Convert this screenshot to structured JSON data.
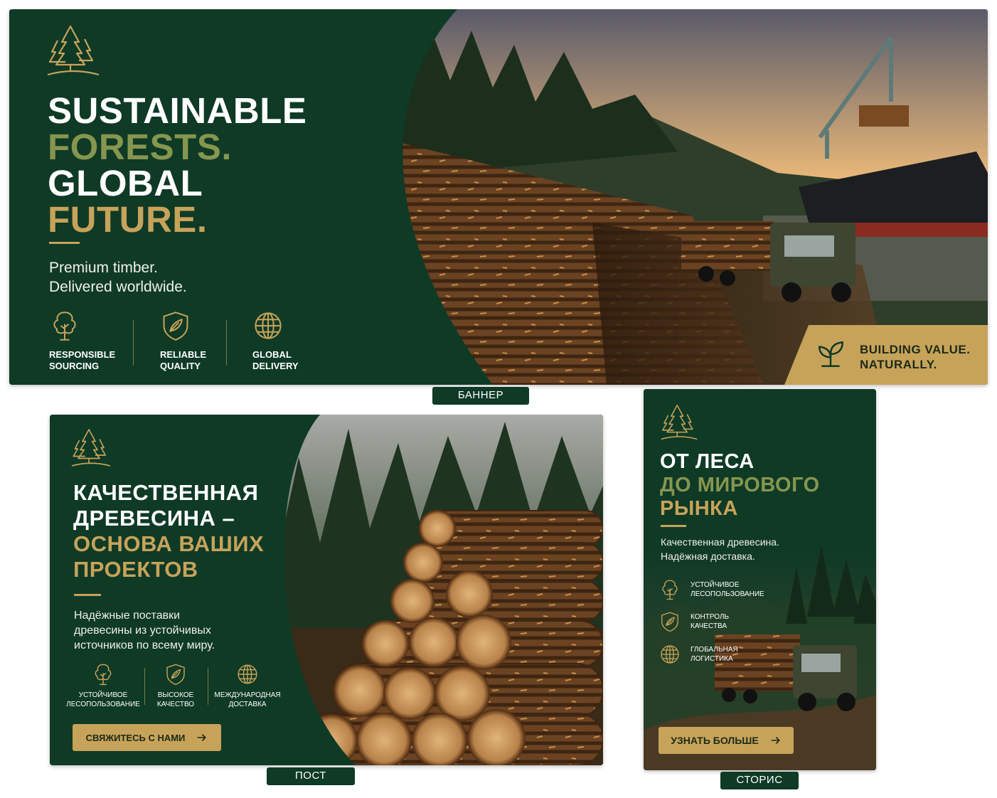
{
  "banner": {
    "headline": [
      "SUSTAINABLE",
      "FORESTS.",
      "GLOBAL",
      "FUTURE."
    ],
    "subtitle": [
      "Premium timber.",
      "Delivered worldwide."
    ],
    "features": [
      {
        "icon": "tree-icon",
        "line1": "RESPONSIBLE",
        "line2": "SOURCING"
      },
      {
        "icon": "shield-icon",
        "line1": "RELIABLE",
        "line2": "QUALITY"
      },
      {
        "icon": "globe-icon",
        "line1": "GLOBAL",
        "line2": "DELIVERY"
      }
    ],
    "badge": [
      "BUILDING VALUE.",
      "NATURALLY."
    ],
    "label": "БАННЕР"
  },
  "post": {
    "headline": [
      "КАЧЕСТВЕННАЯ",
      "ДРЕВЕСИНА –",
      "ОСНОВА ВАШИХ",
      "ПРОЕКТОВ"
    ],
    "subtitle": [
      "Надёжные поставки",
      "древесины из устойчивых",
      "источников по всему миру."
    ],
    "features": [
      {
        "icon": "tree-icon",
        "line1": "УСТОЙЧИВОЕ",
        "line2": "ЛЕСОПОЛЬЗОВАНИЕ"
      },
      {
        "icon": "shield-icon",
        "line1": "ВЫСОКОЕ",
        "line2": "КАЧЕСТВО"
      },
      {
        "icon": "globe-icon",
        "line1": "МЕЖДУНАРОДНАЯ",
        "line2": "ДОСТАВКА"
      }
    ],
    "cta": "СВЯЖИТЕСЬ С НАМИ",
    "label": "ПОСТ"
  },
  "story": {
    "headline": [
      "ОТ ЛЕСА",
      "ДО МИРОВОГО",
      "РЫНКА"
    ],
    "subtitle": [
      "Качественная древесина.",
      "Надёжная доставка."
    ],
    "features": [
      {
        "icon": "tree-icon",
        "line1": "УСТОЙЧИВОЕ",
        "line2": "ЛЕСОПОЛЬЗОВАНИЕ"
      },
      {
        "icon": "shield-icon",
        "line1": "КОНТРОЛЬ",
        "line2": "КАЧЕСТВА"
      },
      {
        "icon": "globe-icon",
        "line1": "ГЛОБАЛЬНАЯ",
        "line2": "ЛОГИСТИКА"
      }
    ],
    "cta": "УЗНАТЬ БОЛЬШЕ",
    "label": "СТОРИС"
  },
  "colors": {
    "green": "#0f3a26",
    "gold": "#c7a35a",
    "olive": "#86964f"
  },
  "arrow_icon": "arrow-right-icon"
}
